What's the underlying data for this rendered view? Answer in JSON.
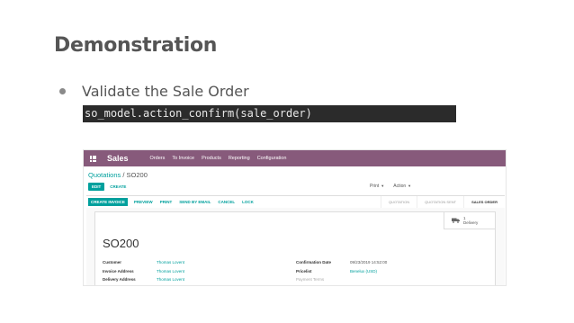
{
  "slide": {
    "title": "Demonstration",
    "bullet": "Validate the Sale Order",
    "code": "so_model.action_confirm(sale_order)"
  },
  "odoo": {
    "app_name": "Sales",
    "menu": [
      "Orders",
      "To Invoice",
      "Products",
      "Reporting",
      "Configuration"
    ],
    "breadcrumb_parent": "Quotations",
    "breadcrumb_sep": " / ",
    "breadcrumb_current": "SO200",
    "edit_label": "EDIT",
    "create_label": "CREATE",
    "print_label": "Print",
    "action_label": "Action",
    "status_buttons": [
      "CREATE INVOICE",
      "PREVIEW",
      "PRINT",
      "SEND BY EMAIL",
      "CANCEL",
      "LOCK"
    ],
    "stages": [
      "QUOTATION",
      "QUOTATION SENT",
      "SALES ORDER"
    ],
    "delivery_count": "1",
    "delivery_label": "Delivery",
    "order_name": "SO200",
    "left_fields": [
      {
        "label": "Customer",
        "value": "Thomas Lovent"
      },
      {
        "label": "Invoice Address",
        "value": "Thomas Lovent"
      },
      {
        "label": "Delivery Address",
        "value": "Thomas Lovent"
      }
    ],
    "right_fields": [
      {
        "label": "Confirmation Date",
        "value": "09/23/2019 14:52:00"
      },
      {
        "label": "Pricelist",
        "value": "Benelux (USD)"
      },
      {
        "label": "Payment Terms",
        "value": ""
      }
    ],
    "colors": {
      "brand": "#875a7b",
      "accent": "#00a09d"
    }
  }
}
